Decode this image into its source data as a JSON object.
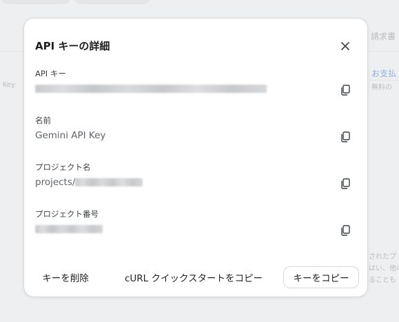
{
  "background": {
    "right_header": "請求書",
    "right_link": "お支払",
    "right_link_sub": "無料の",
    "left_text": "Key",
    "right_notes": [
      "されたプ",
      "はい、他の",
      "ることも"
    ]
  },
  "dialog": {
    "title": "API キーの詳細",
    "close_icon": "close-icon",
    "fields": [
      {
        "label": "API キー",
        "value": "",
        "blurred": true
      },
      {
        "label": "名前",
        "value": "Gemini API Key",
        "blurred": false
      },
      {
        "label": "プロジェクト名",
        "value": "projects/",
        "blurred": true
      },
      {
        "label": "プロジェクト番号",
        "value": "",
        "blurred": true
      }
    ],
    "copy_icon": "copy-icon",
    "footer": {
      "delete_label": "キーを削除",
      "curl_label": "cURL クイックスタートをコピー",
      "copy_key_label": "キーをコピー"
    }
  }
}
